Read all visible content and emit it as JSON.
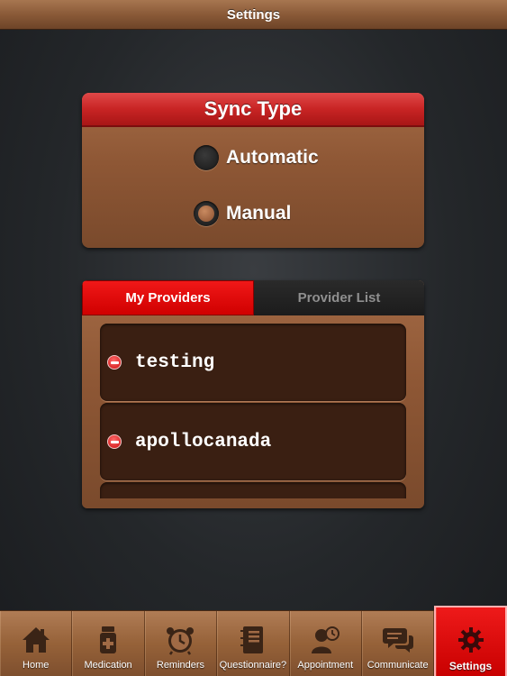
{
  "navbar": {
    "title": "Settings"
  },
  "sync": {
    "title": "Sync Type",
    "options": [
      {
        "label": "Automatic",
        "selected": false
      },
      {
        "label": "Manual",
        "selected": true
      }
    ]
  },
  "providers": {
    "tabs": [
      {
        "label": "My Providers",
        "active": true
      },
      {
        "label": "Provider List",
        "active": false
      }
    ],
    "items": [
      {
        "label": "testing"
      },
      {
        "label": "apollocanada"
      }
    ]
  },
  "tabbar": {
    "items": [
      {
        "label": "Home",
        "icon": "home-icon"
      },
      {
        "label": "Medication",
        "icon": "medication-icon"
      },
      {
        "label": "Reminders",
        "icon": "alarm-clock-icon"
      },
      {
        "label": "Questionnaire?",
        "icon": "notebook-icon"
      },
      {
        "label": "Appointment",
        "icon": "appointment-icon"
      },
      {
        "label": "Communicate",
        "icon": "chat-bubbles-icon"
      },
      {
        "label": "Settings",
        "icon": "gear-icon",
        "active": true
      }
    ]
  },
  "colors": {
    "accent_red": "#d00000",
    "leather_brown": "#8e5735",
    "list_item_dark": "#3a1f12"
  }
}
